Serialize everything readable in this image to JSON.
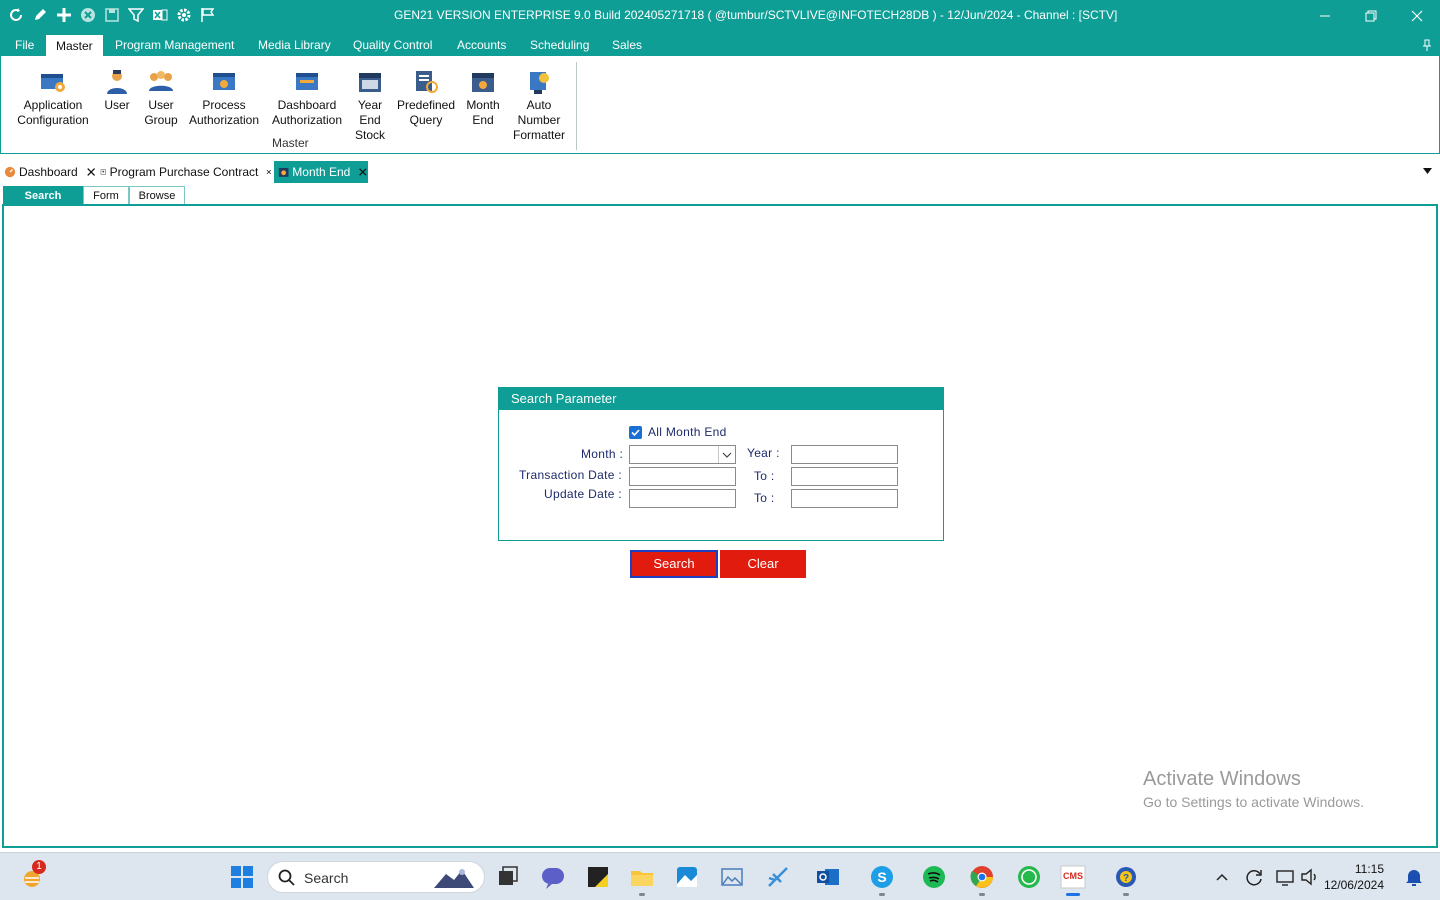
{
  "window": {
    "title": "GEN21 VERSION ENTERPRISE 9.0 Build 202405271718 ( @tumbur/SCTVLIVE@INFOTECH28DB ) - 12/Jun/2024 - Channel : [SCTV]"
  },
  "menu": {
    "items": [
      "File",
      "Master",
      "Program Management",
      "Media Library",
      "Quality Control",
      "Accounts",
      "Scheduling",
      "Sales"
    ],
    "active": "Master"
  },
  "ribbon": {
    "group_label": "Master",
    "buttons": [
      {
        "label_lines": [
          "Application",
          "Configuration"
        ],
        "icon": "settings-window-icon"
      },
      {
        "label_lines": [
          "User"
        ],
        "icon": "user-icon"
      },
      {
        "label_lines": [
          "User",
          "Group"
        ],
        "icon": "user-group-icon"
      },
      {
        "label_lines": [
          "Process",
          "Authorization"
        ],
        "icon": "process-auth-icon"
      },
      {
        "label_lines": [
          "Dashboard",
          "Authorization"
        ],
        "icon": "dashboard-auth-icon"
      },
      {
        "label_lines": [
          "Year",
          "End",
          "Stock"
        ],
        "icon": "calendar-stock-icon"
      },
      {
        "label_lines": [
          "Predefined",
          "Query"
        ],
        "icon": "query-icon"
      },
      {
        "label_lines": [
          "Month",
          "End"
        ],
        "icon": "calendar-month-icon"
      },
      {
        "label_lines": [
          "Auto",
          "Number",
          "Formatter"
        ],
        "icon": "number-formatter-icon"
      }
    ]
  },
  "doc_tabs": [
    {
      "label": "Dashboard",
      "icon": "dashboard-icon",
      "active": false
    },
    {
      "label": "Program Purchase Contract",
      "icon": "contract-icon",
      "active": false
    },
    {
      "label": "Month End",
      "icon": "month-end-icon",
      "active": true
    }
  ],
  "inner_tabs": [
    {
      "label": "Search",
      "active": true
    },
    {
      "label": "Form",
      "active": false
    },
    {
      "label": "Browse",
      "active": false
    }
  ],
  "search_panel": {
    "title": "Search Parameter",
    "all_month_end_label": "All Month End",
    "all_month_end_checked": true,
    "month_label": "Month :",
    "month_value": "",
    "year_label": "Year :",
    "year_value": "",
    "transaction_date_label": "Transaction Date :",
    "transaction_from": "",
    "transaction_to_label": "To :",
    "transaction_to": "",
    "update_date_label": "Update Date :",
    "update_from": "",
    "update_to_label": "To :",
    "update_to": ""
  },
  "actions": {
    "search_label": "Search",
    "clear_label": "Clear"
  },
  "watermark": {
    "line1": "Activate Windows",
    "line2": "Go to Settings to activate Windows."
  },
  "taskbar": {
    "search_placeholder": "Search",
    "time": "11:15",
    "date": "12/06/2024",
    "notification_badge": "1"
  },
  "colors": {
    "accent": "#0e9e95",
    "button_red": "#e11b0e",
    "label_text": "#1d2a6b"
  }
}
